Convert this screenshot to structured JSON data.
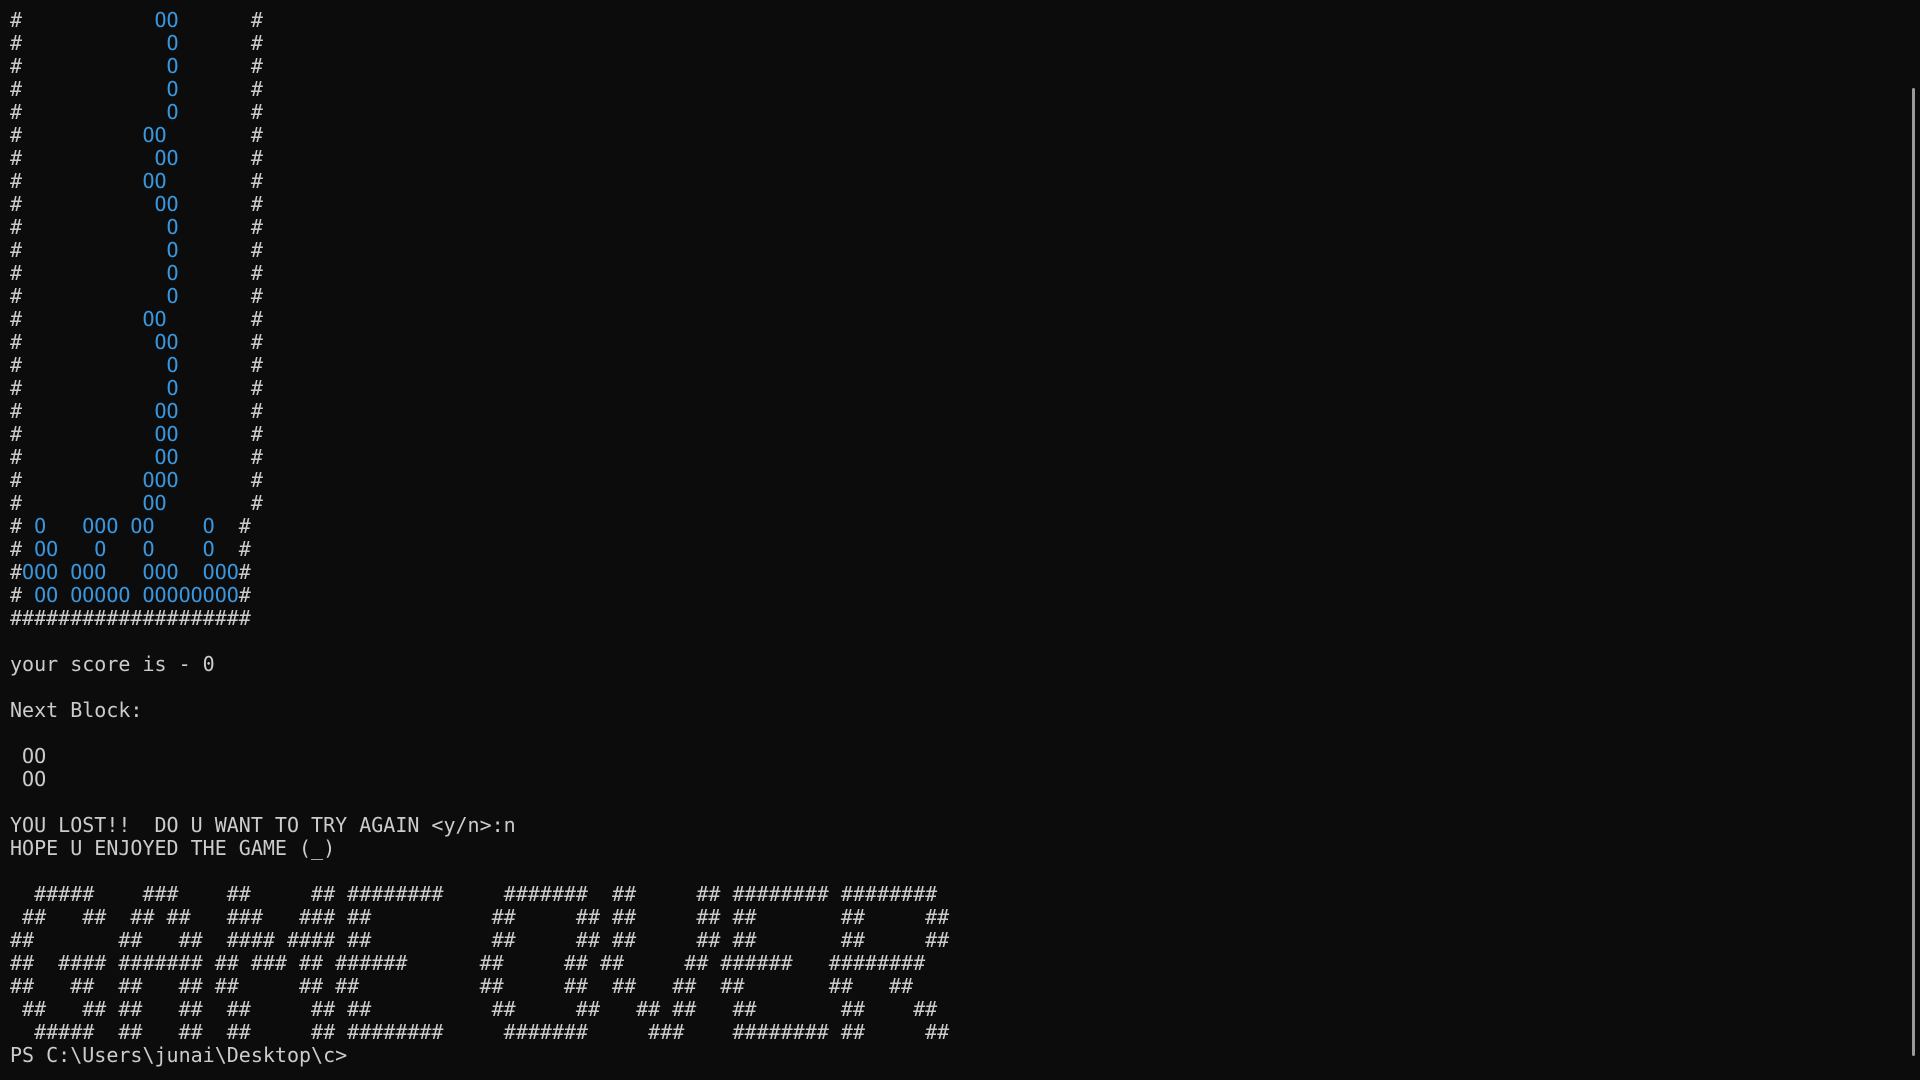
{
  "game": {
    "board_rows": [
      [
        "#",
        "           ",
        "OO",
        "      #"
      ],
      [
        "#",
        "            ",
        "O",
        "      #"
      ],
      [
        "#",
        "            ",
        "O",
        "      #"
      ],
      [
        "#",
        "            ",
        "O",
        "      #"
      ],
      [
        "#",
        "            ",
        "O",
        "      #"
      ],
      [
        "#",
        "          ",
        "OO",
        "       #"
      ],
      [
        "#",
        "           ",
        "OO",
        "      #"
      ],
      [
        "#",
        "          ",
        "OO",
        "       #"
      ],
      [
        "#",
        "           ",
        "OO",
        "      #"
      ],
      [
        "#",
        "            ",
        "O",
        "      #"
      ],
      [
        "#",
        "            ",
        "O",
        "      #"
      ],
      [
        "#",
        "            ",
        "O",
        "      #"
      ],
      [
        "#",
        "            ",
        "O",
        "      #"
      ],
      [
        "#",
        "          ",
        "OO",
        "       #"
      ],
      [
        "#",
        "           ",
        "OO",
        "      #"
      ],
      [
        "#",
        "            ",
        "O",
        "      #"
      ],
      [
        "#",
        "            ",
        "O",
        "      #"
      ],
      [
        "#",
        "           ",
        "OO",
        "      #"
      ],
      [
        "#",
        "           ",
        "OO",
        "      #"
      ],
      [
        "#",
        "           ",
        "OO",
        "      #"
      ],
      [
        "#",
        "          ",
        "OOO",
        "      #"
      ],
      [
        "#",
        "          ",
        "OO",
        "       #"
      ],
      [
        "#",
        " ",
        "O   OOO OO    O",
        "  #"
      ],
      [
        "#",
        " ",
        "OO   O   O    O",
        "  #"
      ],
      [
        "#",
        "",
        "OOO OOO   OOO  OOO",
        "#"
      ],
      [
        "#",
        " ",
        "OO OOOOO OOOOOOOO",
        "#"
      ]
    ],
    "floor": "####################",
    "score_text": "your score is - 0",
    "next_block_label": "Next Block:",
    "next_block_rows": [
      " OO",
      " OO"
    ],
    "lost_prompt": "YOU LOST!!  DO U WANT TO TRY AGAIN <y/n>:n",
    "goodbye": "HOPE U ENJOYED THE GAME (_)",
    "game_over_art": [
      "  #####    ###    ##     ## ########     #######  ##     ## ######## ########",
      " ##   ##  ## ##   ###   ### ##          ##     ## ##     ## ##       ##     ##",
      "##       ##   ##  #### #### ##          ##     ## ##     ## ##       ##     ##",
      "##  #### ####### ## ### ## ######      ##     ## ##     ## ######   ########",
      "##   ##  ##   ## ##     ## ##          ##     ##  ##   ##  ##       ##   ##",
      " ##   ## ##   ##  ##     ## ##          ##     ##   ## ##   ##       ##    ##",
      "  #####  ##   ##  ##     ## ########     #######     ###    ######## ##     ##"
    ]
  },
  "shell": {
    "prompt": "PS C:\\Users\\junai\\Desktop\\c>"
  }
}
